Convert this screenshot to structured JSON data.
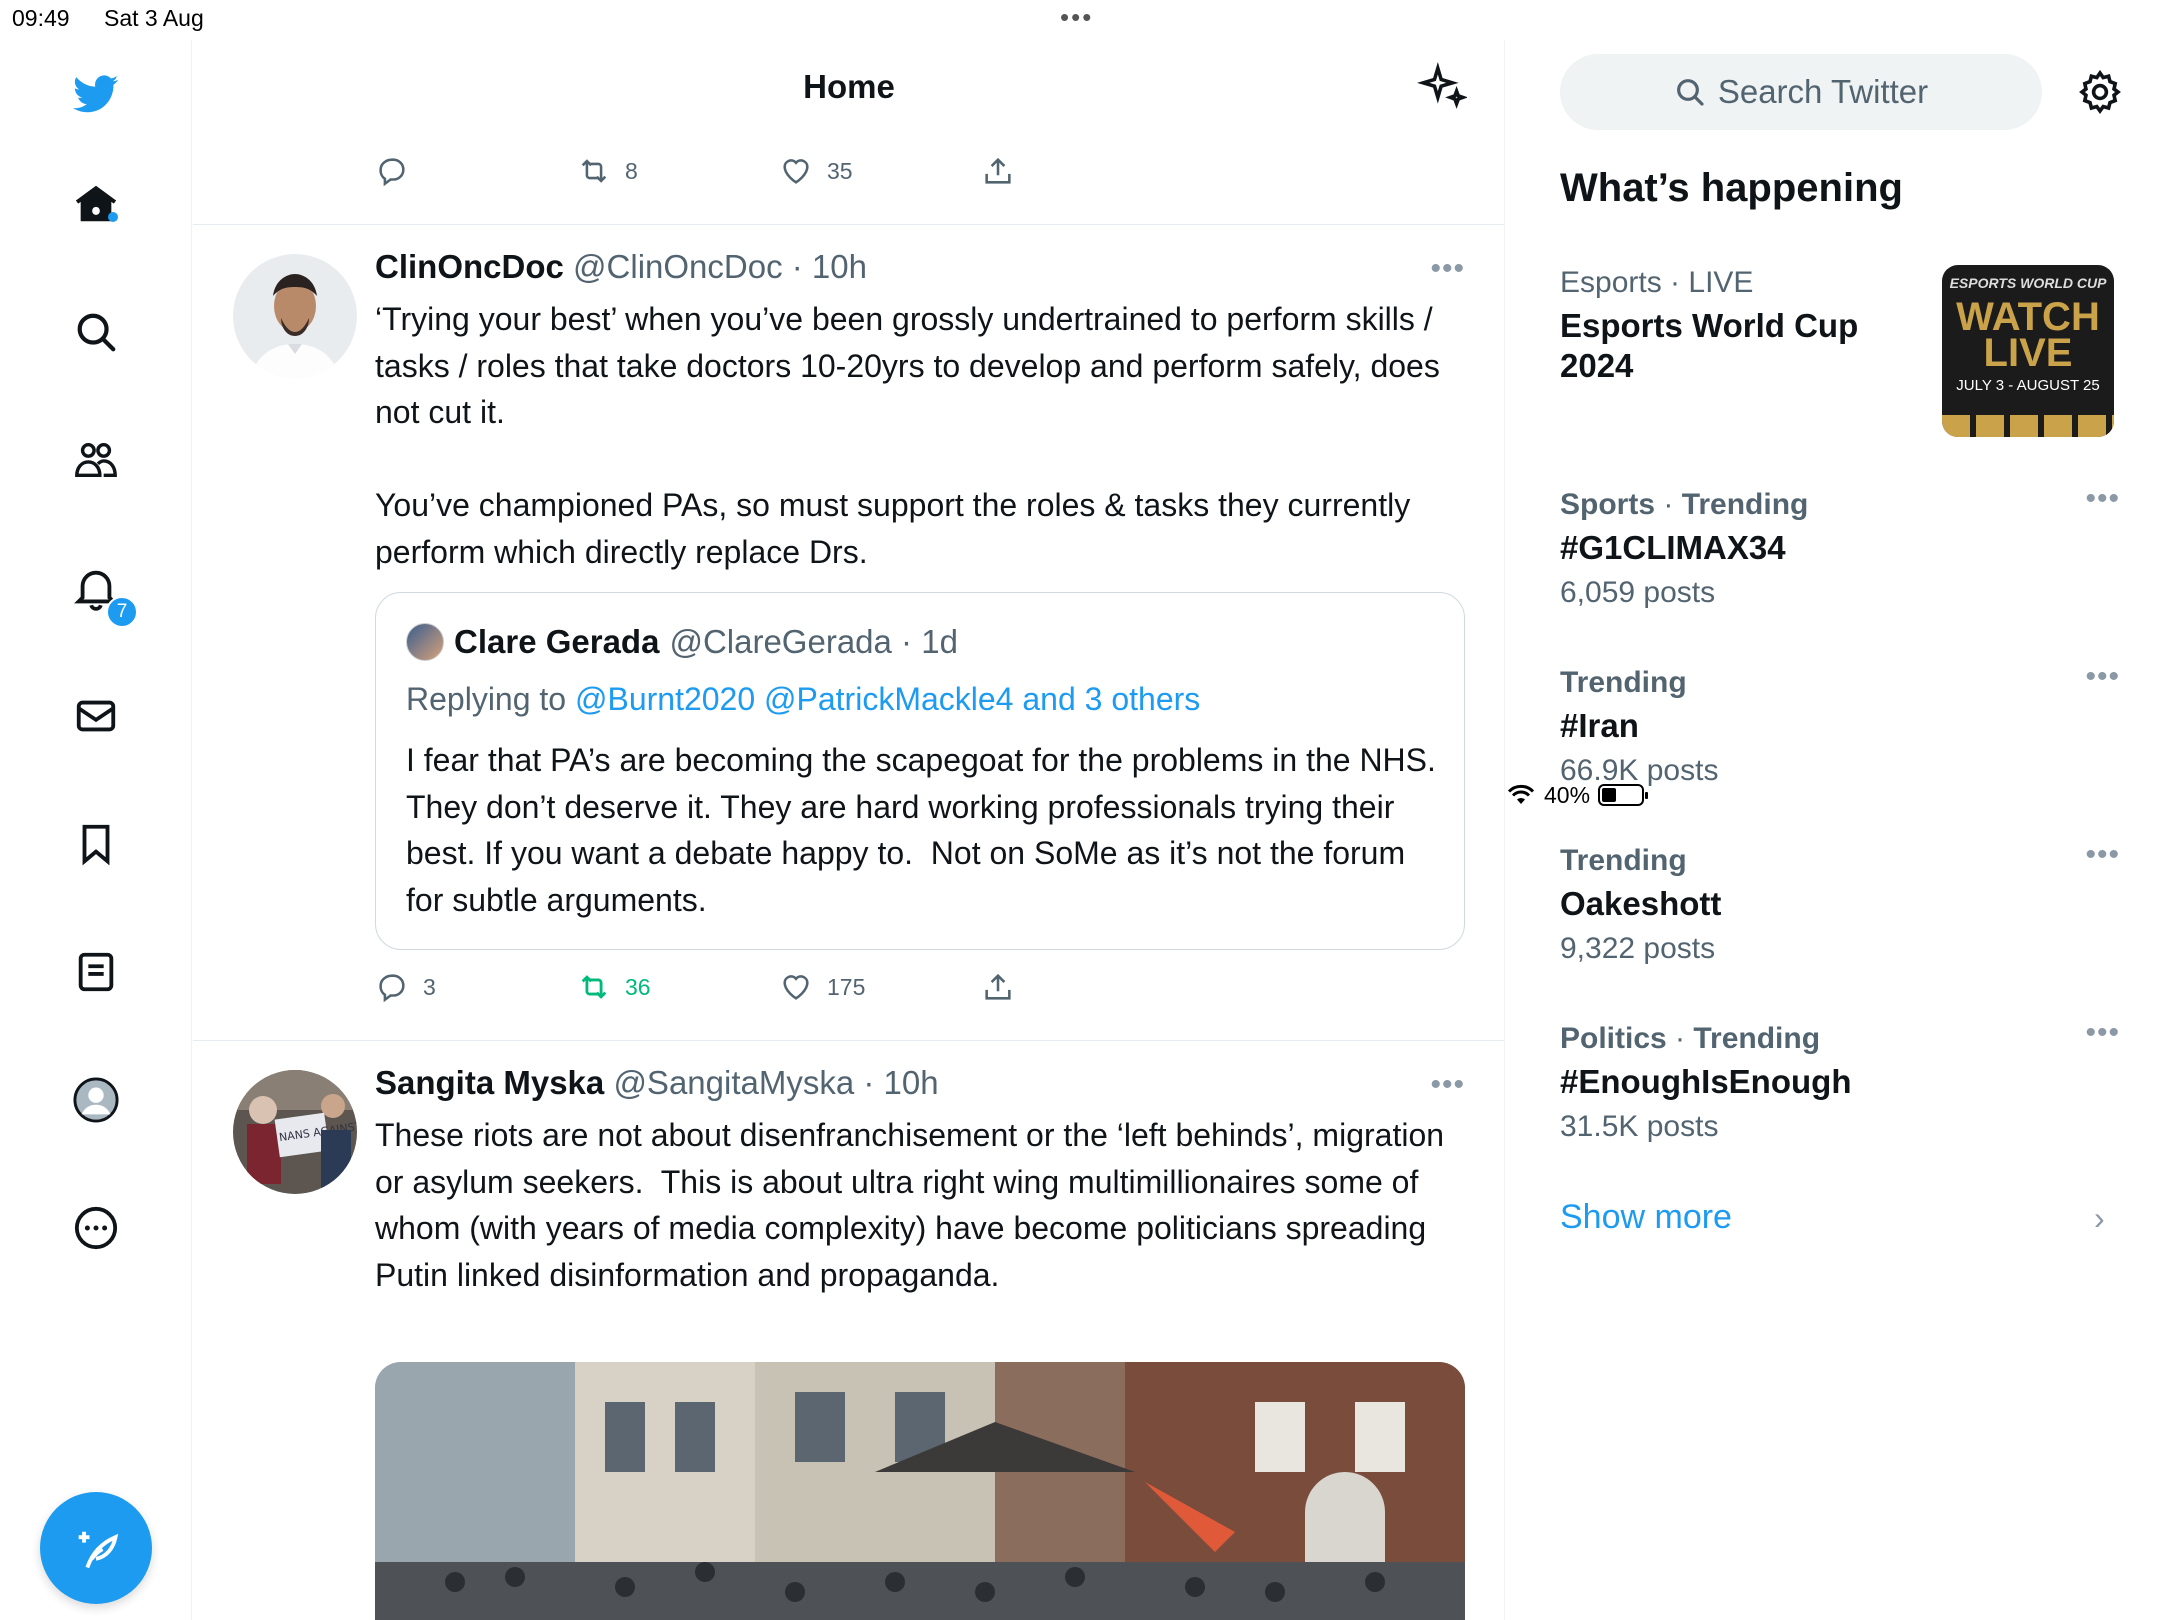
{
  "status_bar": {
    "time": "09:49",
    "date": "Sat 3 Aug",
    "battery": "40%",
    "battery_level": 0.4
  },
  "nav": {
    "notifications_count": "7"
  },
  "header": {
    "title": "Home"
  },
  "top_actions": {
    "retweets": "8",
    "likes": "35"
  },
  "tweets": [
    {
      "name": "ClinOncDoc",
      "handle": "@ClinOncDoc",
      "time": "10h",
      "text": "‘Trying your best’ when you’ve been grossly undertrained to perform skills / tasks / roles that take doctors 10-20yrs to develop and perform safely, does not cut it.\n\nYou’ve championed PAs, so must support the roles & tasks they currently perform which directly replace Drs.",
      "quote": {
        "name": "Clare Gerada",
        "handle": "@ClareGerada",
        "time": "1d",
        "replying_prefix": "Replying to",
        "replying_to": "@Burnt2020 @PatrickMackle4 and 3 others",
        "text": "I fear that PA’s are becoming the scapegoat for the problems in the NHS. They don’t deserve it. They are hard working professionals trying their best. If you want a debate happy to.  Not on SoMe as it’s not the forum for subtle arguments."
      },
      "replies": "3",
      "retweets": "36",
      "likes": "175"
    },
    {
      "name": "Sangita Myska",
      "handle": "@SangitaMyska",
      "time": "10h",
      "text": "These riots are not about disenfranchisement or the ‘left behinds’, migration or asylum seekers.  This is about ultra right wing multimillionaires some of whom (with years of media complexity) have become politicians spreading Putin linked disinformation and propaganda.",
      "avatar_sign": "NANS AGAINST NAZIS"
    }
  ],
  "sidebar": {
    "search_placeholder": "Search Twitter",
    "heading": "What’s happening",
    "trends": [
      {
        "category": "Esports",
        "label": "LIVE",
        "title": "Esports World Cup 2024"
      },
      {
        "category": "Sports",
        "label": "Trending",
        "title": "#G1CLIMAX34",
        "count": "6,059 posts"
      },
      {
        "category": "",
        "label": "Trending",
        "title": "#Iran",
        "count": "66.9K posts"
      },
      {
        "category": "",
        "label": "Trending",
        "title": "Oakeshott",
        "count": "9,322 posts"
      },
      {
        "category": "Politics",
        "label": "Trending",
        "title": "#EnoughIsEnough",
        "count": "31.5K posts"
      }
    ],
    "esports_image": {
      "top": "ESPORTS WORLD CUP",
      "main": "WATCH LIVE",
      "dates": "JULY 3 - AUGUST 25"
    },
    "show_more": "Show more"
  },
  "colors": {
    "accent": "#1d9bf0",
    "retweet_green": "#00ba7c",
    "secondary_text": "#536471"
  }
}
